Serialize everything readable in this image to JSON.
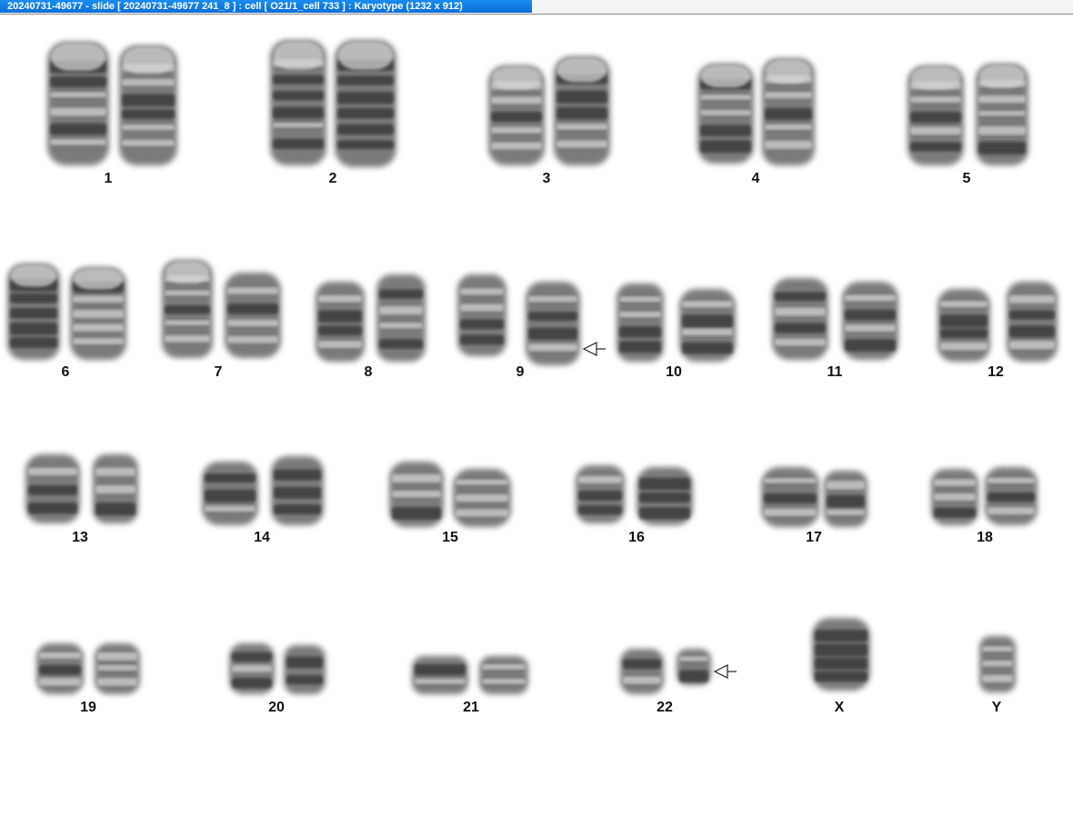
{
  "window": {
    "title": "20240731-49677 - slide [ 20240731-49677 241_8 ] : cell [ O21/1_cell 733 ] : Karyotype  (1232 x 912)"
  },
  "karyotype": {
    "chromosome_labels": [
      "1",
      "2",
      "3",
      "4",
      "5",
      "6",
      "7",
      "8",
      "9",
      "10",
      "11",
      "12",
      "13",
      "14",
      "15",
      "16",
      "17",
      "18",
      "19",
      "20",
      "21",
      "22",
      "X",
      "Y"
    ],
    "marked_chromosomes": [
      "9",
      "22"
    ],
    "marker_icon": "hollow-arrow-left-icon",
    "colors": {
      "chromosome_dark": "#3a3a3a",
      "background": "#ffffff",
      "title_bar": "#0a6fd8"
    }
  }
}
